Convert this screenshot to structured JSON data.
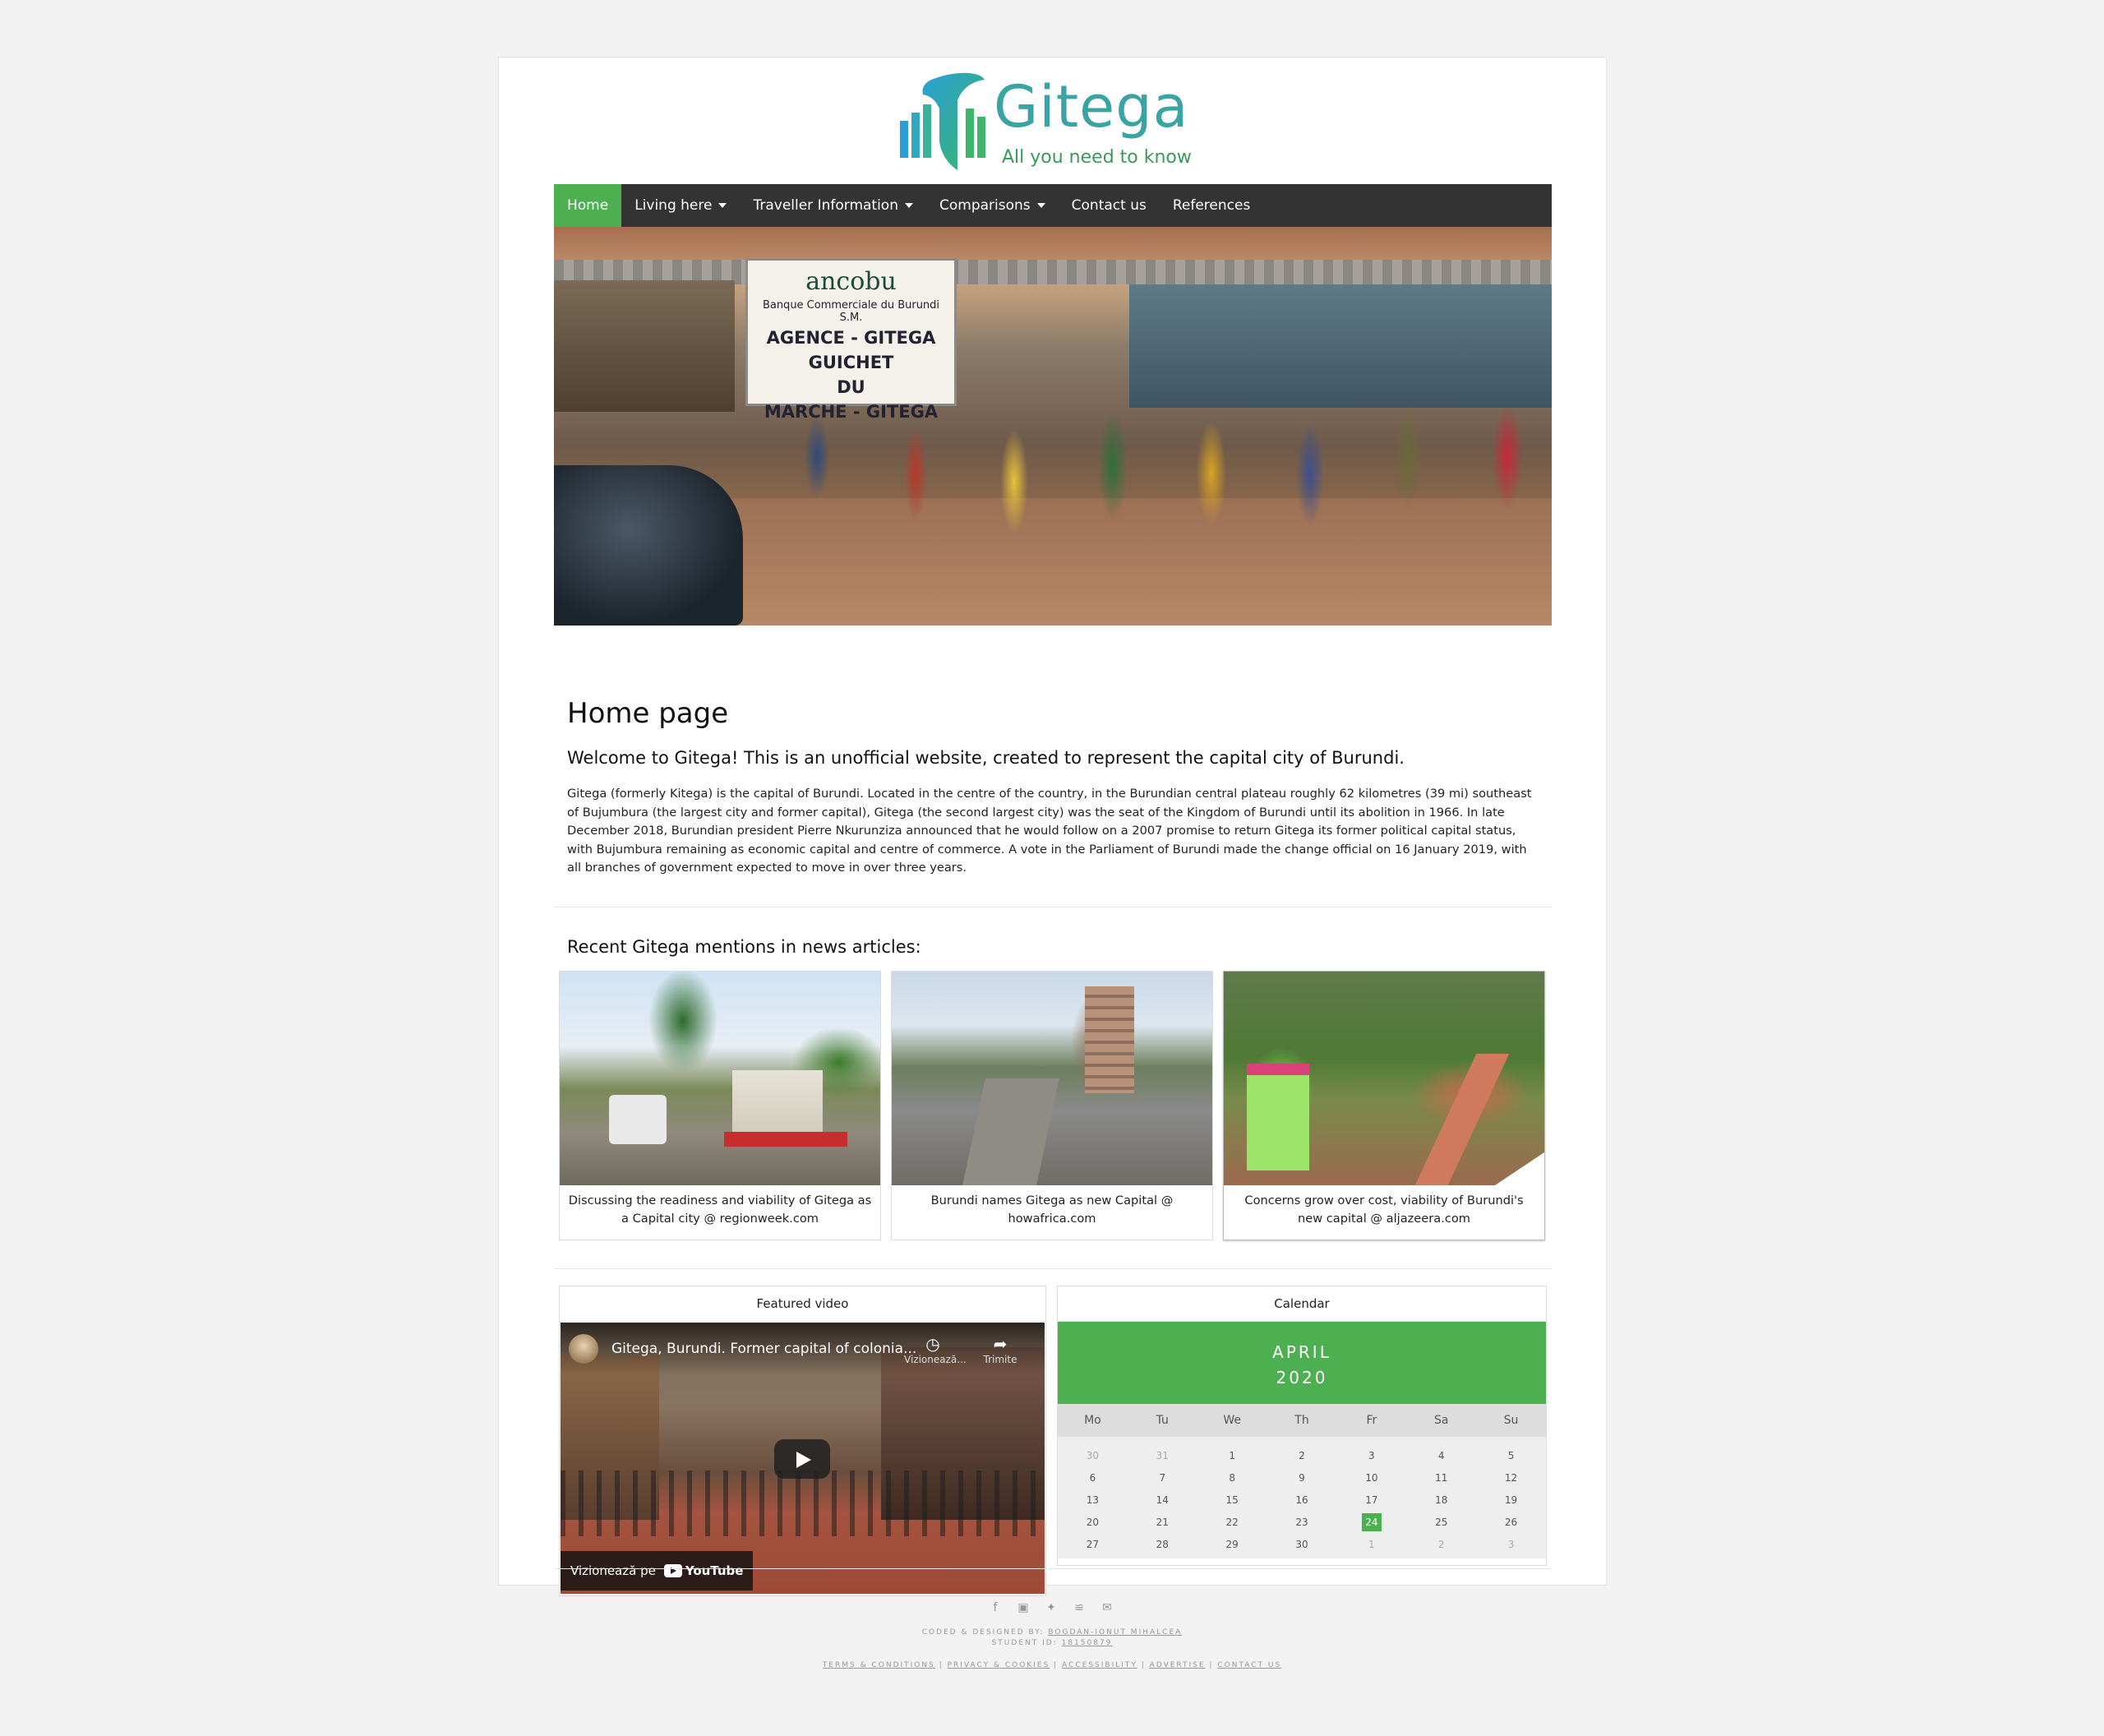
{
  "brand": {
    "name": "Gitega",
    "tagline": "All you need to know",
    "colors": {
      "teal": "#3aa3a3",
      "green": "#4caf50",
      "nav": "#333333"
    }
  },
  "nav": {
    "items": [
      {
        "label": "Home",
        "active": true,
        "dropdown": false
      },
      {
        "label": "Living here",
        "active": false,
        "dropdown": true
      },
      {
        "label": "Traveller Information",
        "active": false,
        "dropdown": true
      },
      {
        "label": "Comparisons",
        "active": false,
        "dropdown": true
      },
      {
        "label": "Contact us",
        "active": false,
        "dropdown": false
      },
      {
        "label": "References",
        "active": false,
        "dropdown": false
      }
    ]
  },
  "hero": {
    "sign_brand": "ancobu",
    "sign_line1": "Banque Commerciale du Burundi S.M.",
    "sign_line2": "AGENCE - GITEGA",
    "sign_line3": "GUICHET",
    "sign_line4": "DU",
    "sign_line5": "MARCHE - GITEGA"
  },
  "main": {
    "title": "Home page",
    "subtitle": "Welcome to Gitega! This is an unofficial website, created to represent the capital city of Burundi.",
    "paragraph": "Gitega (formerly Kitega) is the capital of Burundi. Located in the centre of the country, in the Burundian central plateau roughly 62 kilometres (39 mi) southeast of Bujumbura (the largest city and former capital), Gitega (the second largest city) was the seat of the Kingdom of Burundi until its abolition in 1966. In late December 2018, Burundian president Pierre Nkurunziza announced that he would follow on a 2007 promise to return Gitega its former political capital status, with Bujumbura remaining as economic capital and centre of commerce. A vote in the Parliament of Burundi made the change official on 16 January 2019, with all branches of government expected to move in over three years."
  },
  "news": {
    "heading": "Recent Gitega mentions in news articles:",
    "items": [
      {
        "caption": "Discussing the readiness and viability of Gitega as a Capital city @ regionweek.com"
      },
      {
        "caption": "Burundi names Gitega as new Capital @ howafrica.com"
      },
      {
        "caption": "Concerns grow over cost, viability of Burundi's new capital @ aljazeera.com"
      }
    ]
  },
  "video": {
    "heading": "Featured video",
    "title": "Gitega, Burundi. Former capital of colonia...",
    "watch_later": "Vizionează...",
    "share": "Trimite",
    "watch_on": "Vizionează pe",
    "youtube": "YouTube"
  },
  "calendar": {
    "heading": "Calendar",
    "month": "APRIL",
    "year": "2020",
    "weekdays": [
      "Mo",
      "Tu",
      "We",
      "Th",
      "Fr",
      "Sa",
      "Su"
    ],
    "days": [
      "30",
      "31",
      "1",
      "2",
      "3",
      "4",
      "5",
      "6",
      "7",
      "8",
      "9",
      "10",
      "11",
      "12",
      "13",
      "14",
      "15",
      "16",
      "17",
      "18",
      "19",
      "20",
      "21",
      "22",
      "23",
      "24",
      "25",
      "26",
      "27",
      "28",
      "29",
      "30",
      "1",
      "2",
      "3"
    ],
    "muted_indices": [
      0,
      1,
      32,
      33,
      34
    ],
    "today_index": 25
  },
  "footer": {
    "social_icons": [
      "facebook-icon",
      "instagram-icon",
      "twitter-icon",
      "rss-icon",
      "email-icon"
    ],
    "credit_label": "CODED & DESIGNED BY:",
    "credit_name": "BOGDAN-IONUT MIHALCEA",
    "student_label": "STUDENT ID:",
    "student_id": "18150879",
    "links": [
      "TERMS & CONDITIONS",
      "PRIVACY & COOKIES",
      "ACCESSIBILITY",
      "ADVERTISE",
      "CONTACT US"
    ]
  }
}
